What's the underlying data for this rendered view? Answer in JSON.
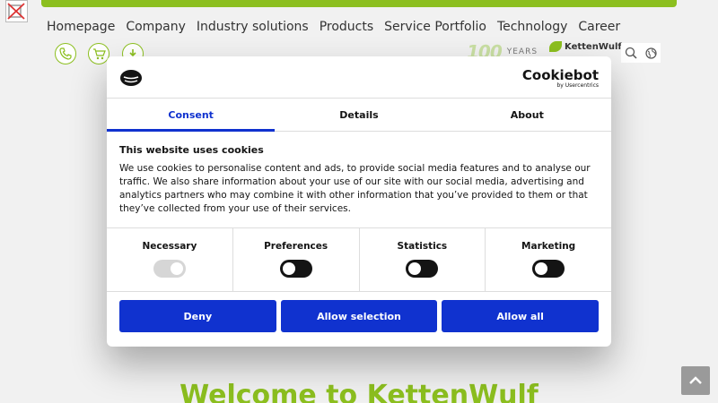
{
  "nav": {
    "items": [
      "Homepage",
      "Company",
      "Industry solutions",
      "Products",
      "Service Portfolio",
      "Technology",
      "Career"
    ]
  },
  "header": {
    "years_number": "100",
    "years_word": "YEARS",
    "brand_name": "KettenWulf"
  },
  "hero": {
    "title": "Welcome to KettenWulf"
  },
  "dialog": {
    "brand": {
      "name": "Cookiebot",
      "sub": "by Usercentrics"
    },
    "tabs": [
      "Consent",
      "Details",
      "About"
    ],
    "heading": "This website uses cookies",
    "body": "We use cookies to personalise content and ads, to provide social media features and to analyse our traffic. We also share information about your use of our site with our social media, advertising and analytics partners who may combine it with other information that you’ve provided to them or that they’ve collected from your use of their services.",
    "categories": [
      {
        "label": "Necessary",
        "enabled": true,
        "locked": true
      },
      {
        "label": "Preferences",
        "enabled": false,
        "locked": false
      },
      {
        "label": "Statistics",
        "enabled": false,
        "locked": false
      },
      {
        "label": "Marketing",
        "enabled": false,
        "locked": false
      }
    ],
    "buttons": {
      "deny": "Deny",
      "allow_selection": "Allow selection",
      "allow_all": "Allow all"
    }
  },
  "colors": {
    "brand_green": "#8cbf1f",
    "cookiebot_blue": "#1032cf"
  },
  "icons": [
    "phone-icon",
    "cart-icon",
    "download-icon",
    "search-icon",
    "globe-icon",
    "chevron-up-icon",
    "cookie-icon"
  ]
}
